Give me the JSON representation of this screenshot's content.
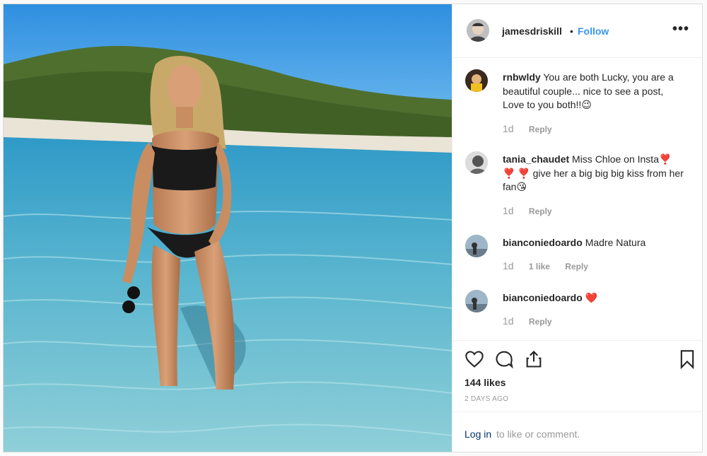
{
  "post": {
    "image_icon": "beach-photo",
    "author": {
      "username": "jamesdriskill",
      "separator": "•",
      "follow_label": "Follow",
      "more_icon": "more-dots-icon",
      "more_label": "•••"
    },
    "comments": [
      {
        "username": "rnbwldy",
        "text": "You are both Lucky, you are a beautiful couple... nice to see a post, Love to you both!!😉",
        "age": "1d",
        "likes": "",
        "reply_label": "Reply"
      },
      {
        "username": "tania_chaudet",
        "text": "Miss Chloe on Insta❣️ ❣️ ❣️  give her a big big big kiss from her fan😘",
        "age": "1d",
        "likes": "",
        "reply_label": "Reply"
      },
      {
        "username": "bianconiedoardo",
        "text": "Madre Natura",
        "age": "1d",
        "likes": "1 like",
        "reply_label": "Reply"
      },
      {
        "username": "bianconiedoardo",
        "text": "❤️",
        "age": "1d",
        "likes": "",
        "reply_label": "Reply"
      }
    ],
    "actions": {
      "like_icon": "heart-icon",
      "comment_icon": "comment-bubble-icon",
      "share_icon": "share-icon",
      "save_icon": "bookmark-icon"
    },
    "likes_count": "144 likes",
    "date": "2 DAYS AGO",
    "login": {
      "link_label": "Log in",
      "rest_text": "to like or comment."
    },
    "colors": {
      "link_blue": "#3897f0",
      "login_blue": "#003569",
      "muted": "#999999",
      "heart_red": "#ed4956"
    }
  }
}
